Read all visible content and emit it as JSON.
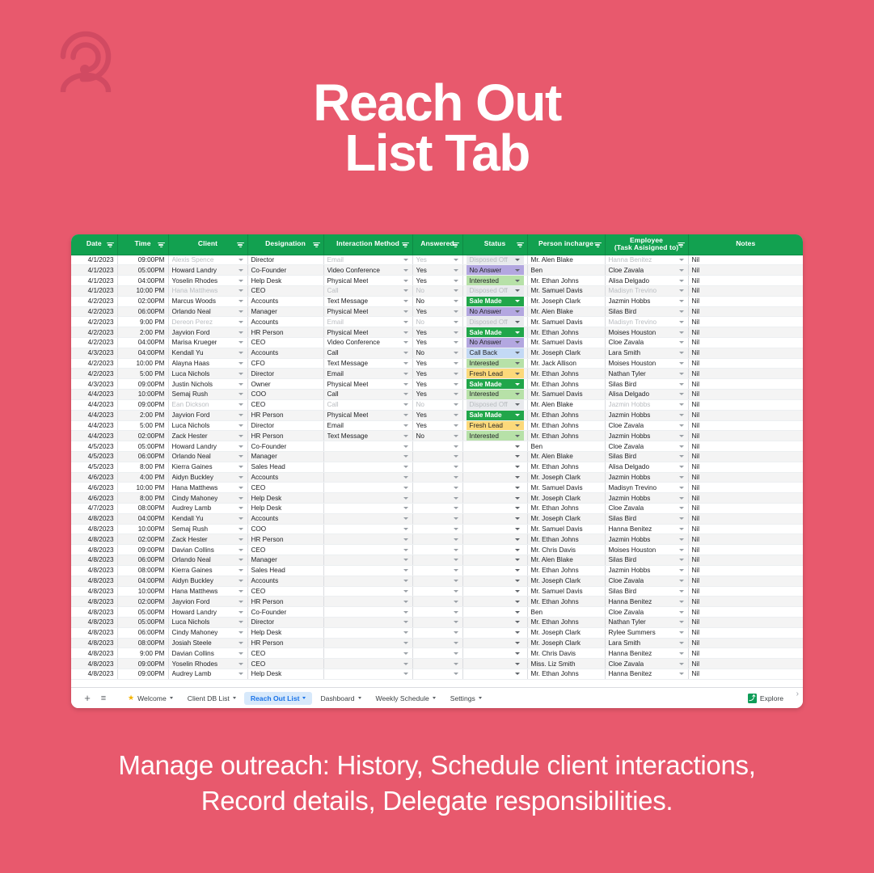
{
  "brand": {
    "accent": "#e8596d",
    "logo_icon": "person-spiral-logo",
    "logo_color": "#d14a62"
  },
  "header": {
    "title_line1": "Reach Out",
    "title_line2": "List Tab"
  },
  "caption": {
    "line1": "Manage outreach: History, Schedule client interactions,",
    "line2": "Record details, Delegate responsibilities."
  },
  "spreadsheet": {
    "columns": [
      "Date",
      "Time",
      "Client",
      "Designation",
      "Interaction Method",
      "Answered",
      "Status",
      "Person incharge",
      "Employee\n(Task Asisigned to)",
      "Notes"
    ],
    "column_employee_line1": "Employee",
    "column_employee_line2": "(Task Asisigned to)",
    "status_colors": {
      "Disposed Off": "#e8eaed",
      "No Answer": "#b3a7e0",
      "Interested": "#b7e1a8",
      "Sale Made": "#21a64a",
      "Call Back": "#c3d9f5",
      "Fresh Lead": "#fcd97a"
    },
    "rows": [
      {
        "faded": true,
        "date": "4/1/2023",
        "time": "09:00PM",
        "client": "Alexis Spence",
        "designation": "Director",
        "method": "Email",
        "answered": "Yes",
        "status": "Disposed Off",
        "person": "Mr. Alen Blake",
        "employee": "Hanna Benitez",
        "notes": "Nil"
      },
      {
        "faded": false,
        "date": "4/1/2023",
        "time": "05:00PM",
        "client": "Howard Landry",
        "designation": "Co-Founder",
        "method": "Video Conference",
        "answered": "Yes",
        "status": "No Answer",
        "person": "Ben",
        "employee": "Cloe Zavala",
        "notes": "Nil"
      },
      {
        "faded": false,
        "date": "4/1/2023",
        "time": "04:00PM",
        "client": "Yoselin Rhodes",
        "designation": "Help Desk",
        "method": "Physical Meet",
        "answered": "Yes",
        "status": "Interested",
        "person": "Mr. Ethan Johns",
        "employee": "Alisa Delgado",
        "notes": "Nil"
      },
      {
        "faded": true,
        "date": "4/1/2023",
        "time": "10:00 PM",
        "client": "Hana Matthews",
        "designation": "CEO",
        "method": "Call",
        "answered": "No",
        "status": "Disposed Off",
        "person": "Mr. Samuel Davis",
        "employee": "Madisyn Trevino",
        "notes": "Nil"
      },
      {
        "faded": false,
        "date": "4/2/2023",
        "time": "02:00PM",
        "client": "Marcus Woods",
        "designation": "Accounts",
        "method": "Text Message",
        "answered": "No",
        "status": "Sale Made",
        "person": "Mr. Joseph Clark",
        "employee": "Jazmin Hobbs",
        "notes": "Nil"
      },
      {
        "faded": false,
        "date": "4/2/2023",
        "time": "06:00PM",
        "client": "Orlando Neal",
        "designation": "Manager",
        "method": "Physical Meet",
        "answered": "Yes",
        "status": "No Answer",
        "person": "Mr. Alen Blake",
        "employee": "Silas Bird",
        "notes": "Nil"
      },
      {
        "faded": true,
        "date": "4/2/2023",
        "time": "9:00 PM",
        "client": "Dereon Perez",
        "designation": "Accounts",
        "method": "Email",
        "answered": "No",
        "status": "Disposed Off",
        "person": "Mr. Samuel Davis",
        "employee": "Madisyn Trevino",
        "notes": "Nil"
      },
      {
        "faded": false,
        "date": "4/2/2023",
        "time": "2:00 PM",
        "client": "Jayvion Ford",
        "designation": "HR Person",
        "method": "Physical Meet",
        "answered": "Yes",
        "status": "Sale Made",
        "person": "Mr. Ethan Johns",
        "employee": "Moises Houston",
        "notes": "Nil"
      },
      {
        "faded": false,
        "date": "4/2/2023",
        "time": "04:00PM",
        "client": "Marisa Krueger",
        "designation": "CEO",
        "method": "Video Conference",
        "answered": "Yes",
        "status": "No Answer",
        "person": "Mr. Samuel Davis",
        "employee": "Cloe Zavala",
        "notes": "Nil"
      },
      {
        "faded": false,
        "date": "4/3/2023",
        "time": "04:00PM",
        "client": "Kendall Yu",
        "designation": "Accounts",
        "method": "Call",
        "answered": "No",
        "status": "Call Back",
        "person": "Mr. Joseph Clark",
        "employee": "Lara Smith",
        "notes": "Nil"
      },
      {
        "faded": false,
        "date": "4/2/2023",
        "time": "10:00 PM",
        "client": "Alayna Haas",
        "designation": "CFO",
        "method": "Text Message",
        "answered": "Yes",
        "status": "Interested",
        "person": "Mr. Jack Allison",
        "employee": "Moises Houston",
        "notes": "Nil"
      },
      {
        "faded": false,
        "date": "4/2/2023",
        "time": "5:00 PM",
        "client": "Luca Nichols",
        "designation": "Director",
        "method": "Email",
        "answered": "Yes",
        "status": "Fresh Lead",
        "person": "Mr. Ethan Johns",
        "employee": "Nathan Tyler",
        "notes": "Nil"
      },
      {
        "faded": false,
        "date": "4/3/2023",
        "time": "09:00PM",
        "client": "Justin Nichols",
        "designation": "Owner",
        "method": "Physical Meet",
        "answered": "Yes",
        "status": "Sale Made",
        "person": "Mr. Ethan Johns",
        "employee": "Silas Bird",
        "notes": "Nil"
      },
      {
        "faded": false,
        "date": "4/4/2023",
        "time": "10:00PM",
        "client": "Semaj Rush",
        "designation": "COO",
        "method": "Call",
        "answered": "Yes",
        "status": "Interested",
        "person": "Mr. Samuel Davis",
        "employee": "Alisa Delgado",
        "notes": "Nil"
      },
      {
        "faded": true,
        "date": "4/4/2023",
        "time": "09:00PM",
        "client": "Ean Dickson",
        "designation": "CEO",
        "method": "Call",
        "answered": "No",
        "status": "Disposed Off",
        "person": "Mr. Alen Blake",
        "employee": "Jazmin Hobbs",
        "notes": "Nil"
      },
      {
        "faded": false,
        "date": "4/4/2023",
        "time": "2:00 PM",
        "client": "Jayvion Ford",
        "designation": "HR Person",
        "method": "Physical Meet",
        "answered": "Yes",
        "status": "Sale Made",
        "person": "Mr. Ethan Johns",
        "employee": "Jazmin Hobbs",
        "notes": "Nil"
      },
      {
        "faded": false,
        "date": "4/4/2023",
        "time": "5:00 PM",
        "client": "Luca Nichols",
        "designation": "Director",
        "method": "Email",
        "answered": "Yes",
        "status": "Fresh Lead",
        "person": "Mr. Ethan Johns",
        "employee": "Cloe Zavala",
        "notes": "Nil"
      },
      {
        "faded": false,
        "date": "4/4/2023",
        "time": "02:00PM",
        "client": "Zack Hester",
        "designation": "HR Person",
        "method": "Text Message",
        "answered": "No",
        "status": "Interested",
        "person": "Mr. Ethan Johns",
        "employee": "Jazmin Hobbs",
        "notes": "Nil"
      },
      {
        "faded": false,
        "date": "4/5/2023",
        "time": "05:00PM",
        "client": "Howard Landry",
        "designation": "Co-Founder",
        "method": "",
        "answered": "",
        "status": "",
        "person": "Ben",
        "employee": "Cloe Zavala",
        "notes": "Nil"
      },
      {
        "faded": false,
        "date": "4/5/2023",
        "time": "06:00PM",
        "client": "Orlando Neal",
        "designation": "Manager",
        "method": "",
        "answered": "",
        "status": "",
        "person": "Mr. Alen Blake",
        "employee": "Silas Bird",
        "notes": "Nil"
      },
      {
        "faded": false,
        "date": "4/5/2023",
        "time": "8:00 PM",
        "client": "Kierra Gaines",
        "designation": "Sales Head",
        "method": "",
        "answered": "",
        "status": "",
        "person": "Mr. Ethan Johns",
        "employee": "Alisa Delgado",
        "notes": "Nil"
      },
      {
        "faded": false,
        "date": "4/6/2023",
        "time": "4:00 PM",
        "client": "Aidyn Buckley",
        "designation": "Accounts",
        "method": "",
        "answered": "",
        "status": "",
        "person": "Mr. Joseph Clark",
        "employee": "Jazmin Hobbs",
        "notes": "Nil"
      },
      {
        "faded": false,
        "date": "4/6/2023",
        "time": "10:00 PM",
        "client": "Hana Matthews",
        "designation": "CEO",
        "method": "",
        "answered": "",
        "status": "",
        "person": "Mr. Samuel Davis",
        "employee": "Madisyn Trevino",
        "notes": "Nil"
      },
      {
        "faded": false,
        "date": "4/6/2023",
        "time": "8:00 PM",
        "client": "Cindy Mahoney",
        "designation": "Help Desk",
        "method": "",
        "answered": "",
        "status": "",
        "person": "Mr. Joseph Clark",
        "employee": "Jazmin Hobbs",
        "notes": "Nil"
      },
      {
        "faded": false,
        "date": "4/7/2023",
        "time": "08:00PM",
        "client": "Audrey Lamb",
        "designation": "Help Desk",
        "method": "",
        "answered": "",
        "status": "",
        "person": "Mr. Ethan Johns",
        "employee": "Cloe Zavala",
        "notes": "Nil"
      },
      {
        "faded": false,
        "date": "4/8/2023",
        "time": "04:00PM",
        "client": "Kendall Yu",
        "designation": "Accounts",
        "method": "",
        "answered": "",
        "status": "",
        "person": "Mr. Joseph Clark",
        "employee": "Silas Bird",
        "notes": "Nil"
      },
      {
        "faded": false,
        "date": "4/8/2023",
        "time": "10:00PM",
        "client": "Semaj Rush",
        "designation": "COO",
        "method": "",
        "answered": "",
        "status": "",
        "person": "Mr. Samuel Davis",
        "employee": "Hanna Benitez",
        "notes": "Nil"
      },
      {
        "faded": false,
        "date": "4/8/2023",
        "time": "02:00PM",
        "client": "Zack Hester",
        "designation": "HR Person",
        "method": "",
        "answered": "",
        "status": "",
        "person": "Mr. Ethan Johns",
        "employee": "Jazmin Hobbs",
        "notes": "Nil"
      },
      {
        "faded": false,
        "date": "4/8/2023",
        "time": "09:00PM",
        "client": "Davian Collins",
        "designation": "CEO",
        "method": "",
        "answered": "",
        "status": "",
        "person": "Mr. Chris Davis",
        "employee": "Moises Houston",
        "notes": "Nil"
      },
      {
        "faded": false,
        "date": "4/8/2023",
        "time": "06:00PM",
        "client": "Orlando Neal",
        "designation": "Manager",
        "method": "",
        "answered": "",
        "status": "",
        "person": "Mr. Alen Blake",
        "employee": "Silas Bird",
        "notes": "Nil"
      },
      {
        "faded": false,
        "date": "4/8/2023",
        "time": "08:00PM",
        "client": "Kierra Gaines",
        "designation": "Sales Head",
        "method": "",
        "answered": "",
        "status": "",
        "person": "Mr. Ethan Johns",
        "employee": "Jazmin Hobbs",
        "notes": "Nil"
      },
      {
        "faded": false,
        "date": "4/8/2023",
        "time": "04:00PM",
        "client": "Aidyn Buckley",
        "designation": "Accounts",
        "method": "",
        "answered": "",
        "status": "",
        "person": "Mr. Joseph Clark",
        "employee": "Cloe Zavala",
        "notes": "Nil"
      },
      {
        "faded": false,
        "date": "4/8/2023",
        "time": "10:00PM",
        "client": "Hana Matthews",
        "designation": "CEO",
        "method": "",
        "answered": "",
        "status": "",
        "person": "Mr. Samuel Davis",
        "employee": "Silas Bird",
        "notes": "Nil"
      },
      {
        "faded": false,
        "date": "4/8/2023",
        "time": "02:00PM",
        "client": "Jayvion Ford",
        "designation": "HR Person",
        "method": "",
        "answered": "",
        "status": "",
        "person": "Mr. Ethan Johns",
        "employee": "Hanna Benitez",
        "notes": "Nil"
      },
      {
        "faded": false,
        "date": "4/8/2023",
        "time": "05:00PM",
        "client": "Howard Landry",
        "designation": "Co-Founder",
        "method": "",
        "answered": "",
        "status": "",
        "person": "Ben",
        "employee": "Cloe Zavala",
        "notes": "Nil"
      },
      {
        "faded": false,
        "date": "4/8/2023",
        "time": "05:00PM",
        "client": "Luca Nichols",
        "designation": "Director",
        "method": "",
        "answered": "",
        "status": "",
        "person": "Mr. Ethan Johns",
        "employee": "Nathan Tyler",
        "notes": "Nil"
      },
      {
        "faded": false,
        "date": "4/8/2023",
        "time": "06:00PM",
        "client": "Cindy Mahoney",
        "designation": "Help Desk",
        "method": "",
        "answered": "",
        "status": "",
        "person": "Mr. Joseph Clark",
        "employee": "Rylee Summers",
        "notes": "Nil"
      },
      {
        "faded": false,
        "date": "4/8/2023",
        "time": "08:00PM",
        "client": "Josiah Steele",
        "designation": "HR Person",
        "method": "",
        "answered": "",
        "status": "",
        "person": "Mr. Joseph Clark",
        "employee": "Lara Smith",
        "notes": "Nil"
      },
      {
        "faded": false,
        "date": "4/8/2023",
        "time": "9:00 PM",
        "client": "Davian Collins",
        "designation": "CEO",
        "method": "",
        "answered": "",
        "status": "",
        "person": "Mr. Chris Davis",
        "employee": "Hanna Benitez",
        "notes": "Nil"
      },
      {
        "faded": false,
        "date": "4/8/2023",
        "time": "09:00PM",
        "client": "Yoselin Rhodes",
        "designation": "CEO",
        "method": "",
        "answered": "",
        "status": "",
        "person": "Miss. Liz Smith",
        "employee": "Cloe Zavala",
        "notes": "Nil"
      },
      {
        "faded": false,
        "date": "4/8/2023",
        "time": "09:00PM",
        "client": "Audrey Lamb",
        "designation": "Help Desk",
        "method": "",
        "answered": "",
        "status": "",
        "person": "Mr. Ethan Johns",
        "employee": "Hanna Benitez",
        "notes": "Nil"
      }
    ]
  },
  "tabbar": {
    "add_label": "+",
    "all_sheets_label": "≡",
    "tabs": [
      {
        "label": "Welcome",
        "active": false,
        "shield": true
      },
      {
        "label": "Client DB List",
        "active": false,
        "shield": false
      },
      {
        "label": "Reach Out List",
        "active": true,
        "shield": false
      },
      {
        "label": "Dashboard",
        "active": false,
        "shield": false
      },
      {
        "label": "Weekly Schedule",
        "active": false,
        "shield": false
      },
      {
        "label": "Settings",
        "active": false,
        "shield": false
      }
    ],
    "explore_label": "Explore",
    "explore_icon_glyph": "⤴"
  }
}
